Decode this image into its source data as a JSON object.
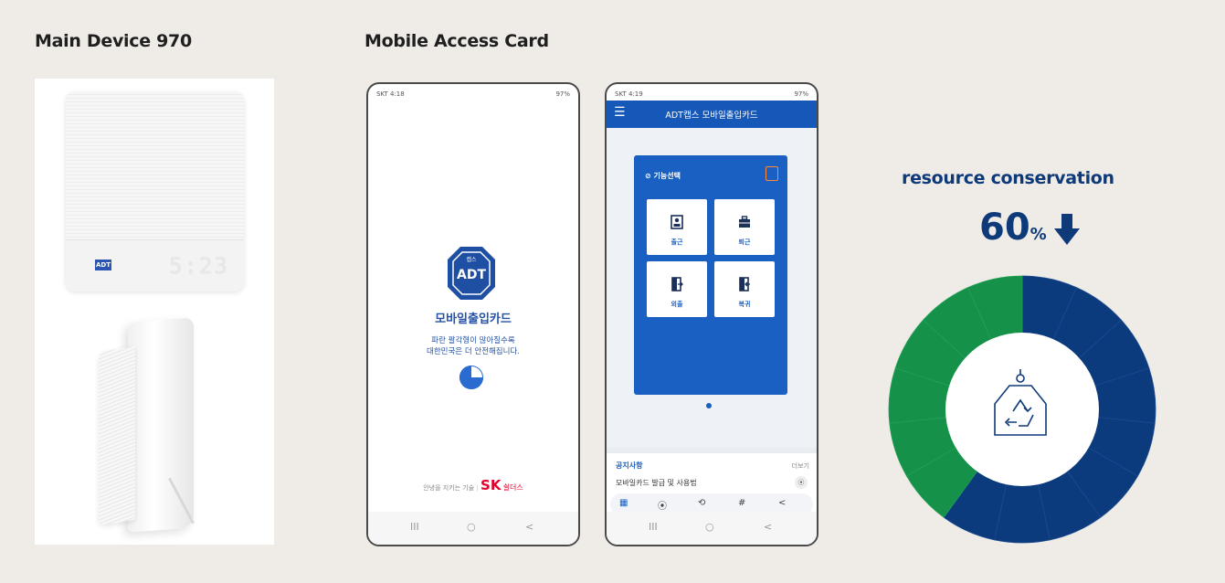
{
  "sections": {
    "main_device_title": "Main Device 970",
    "mobile_card_title": "Mobile Access Card"
  },
  "device": {
    "logo_text": "ADT",
    "clock_display": "5:23"
  },
  "phone1": {
    "status_left": "SKT 4:18",
    "status_right": "97%",
    "badge_top": "캡스",
    "badge_text": "ADT",
    "app_name": "모바일출입카드",
    "message": "파란 팔각형이 많아질수록\n대한민국은 더 안전해집니다.",
    "footer_text": "안녕을 지키는 기술",
    "brand_logo": "SK",
    "brand_name": "쉴더스",
    "nav": [
      "III",
      "○",
      "<"
    ]
  },
  "phone2": {
    "status_left": "SKT 4:19",
    "status_right": "97%",
    "header_title": "ADT캡스 모바일출입카드",
    "card_heading": "⊘ 기능선택",
    "tiles": [
      {
        "label": "출근",
        "icon": "id-card-icon"
      },
      {
        "label": "퇴근",
        "icon": "briefcase-icon"
      },
      {
        "label": "외출",
        "icon": "door-exit-icon"
      },
      {
        "label": "복귀",
        "icon": "door-return-icon"
      }
    ],
    "notice_heading": "공지사항",
    "notice_more": "더보기",
    "notice_item": "모바일카드 발급 및 사용법",
    "tabbar": [
      "▦",
      "⦿",
      "⟲",
      "#",
      "<"
    ],
    "nav": [
      "III",
      "○",
      "<"
    ]
  },
  "conservation": {
    "title": "resource conservation",
    "percent": "60",
    "unit": "%",
    "saved_fraction": 0.4,
    "colors": {
      "navy": "#0b3b7d",
      "green": "#15914a"
    }
  }
}
